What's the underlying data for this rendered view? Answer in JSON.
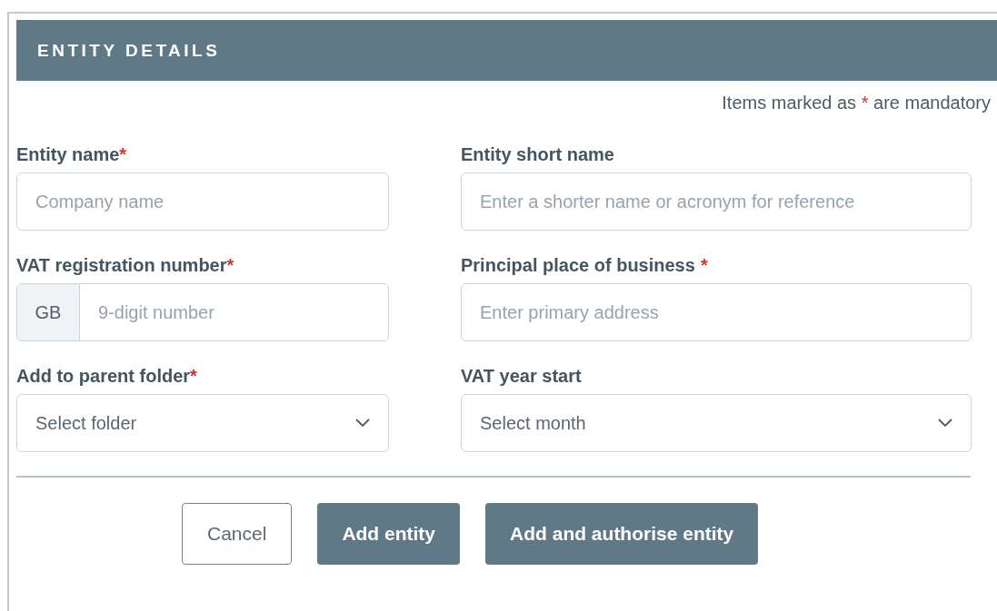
{
  "panel": {
    "title": "ENTITY DETAILS"
  },
  "note": {
    "before": "Items marked as",
    "mark": "*",
    "after": "are mandatory"
  },
  "fields": [
    {
      "kind": "text",
      "label": "Entity name",
      "required_mark": "*",
      "mark_spaced": false,
      "placeholder": "Company name"
    },
    {
      "kind": "text",
      "label": "Entity short name",
      "placeholder": "Enter a shorter name or acronym for reference"
    },
    {
      "kind": "prefixed",
      "label": "VAT registration number",
      "required_mark": "*",
      "mark_spaced": false,
      "prefix": "GB",
      "placeholder": "9-digit number"
    },
    {
      "kind": "text",
      "label": "Principal place of business",
      "required_mark": "*",
      "mark_spaced": true,
      "placeholder": "Enter primary address"
    },
    {
      "kind": "select",
      "label": "Add to parent folder",
      "required_mark": "*",
      "mark_spaced": false,
      "placeholder": "Select folder"
    },
    {
      "kind": "select",
      "label": "VAT year start",
      "placeholder": "Select month"
    }
  ],
  "buttons": [
    {
      "kind": "secondary",
      "label": "Cancel"
    },
    {
      "kind": "primary",
      "label": "Add entity"
    },
    {
      "kind": "primary",
      "label": "Add and authorise entity"
    }
  ]
}
